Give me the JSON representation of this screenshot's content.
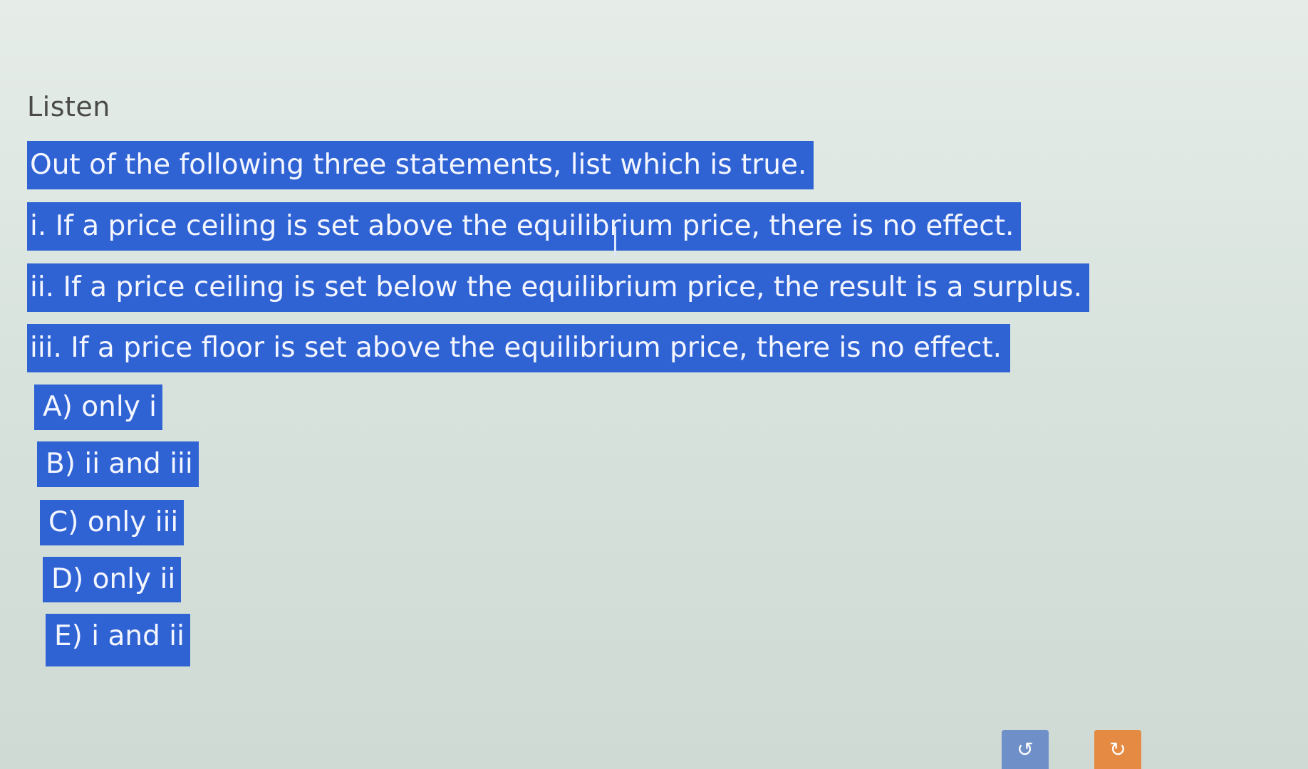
{
  "listen_label": "Listen",
  "question": {
    "stem": "Out of the following three statements, list which is true.",
    "statements": [
      "i. If a price ceiling is set above the equilibrium price, there is no effect.",
      "ii. If a price ceiling is set below the equilibrium price, the result is a surplus.",
      "iii. If a price floor is set above the equilibrium price, there is no effect."
    ]
  },
  "options": [
    "A) only i",
    "B) ii and iii",
    "C) only iii",
    "D) only ii",
    "E) i and ii"
  ],
  "icons": {
    "undo": "undo-icon",
    "redo": "redo-icon"
  },
  "colors": {
    "highlight": "#2f63d4",
    "undo_button": "#6f8fc9",
    "redo_button": "#e48a42"
  }
}
